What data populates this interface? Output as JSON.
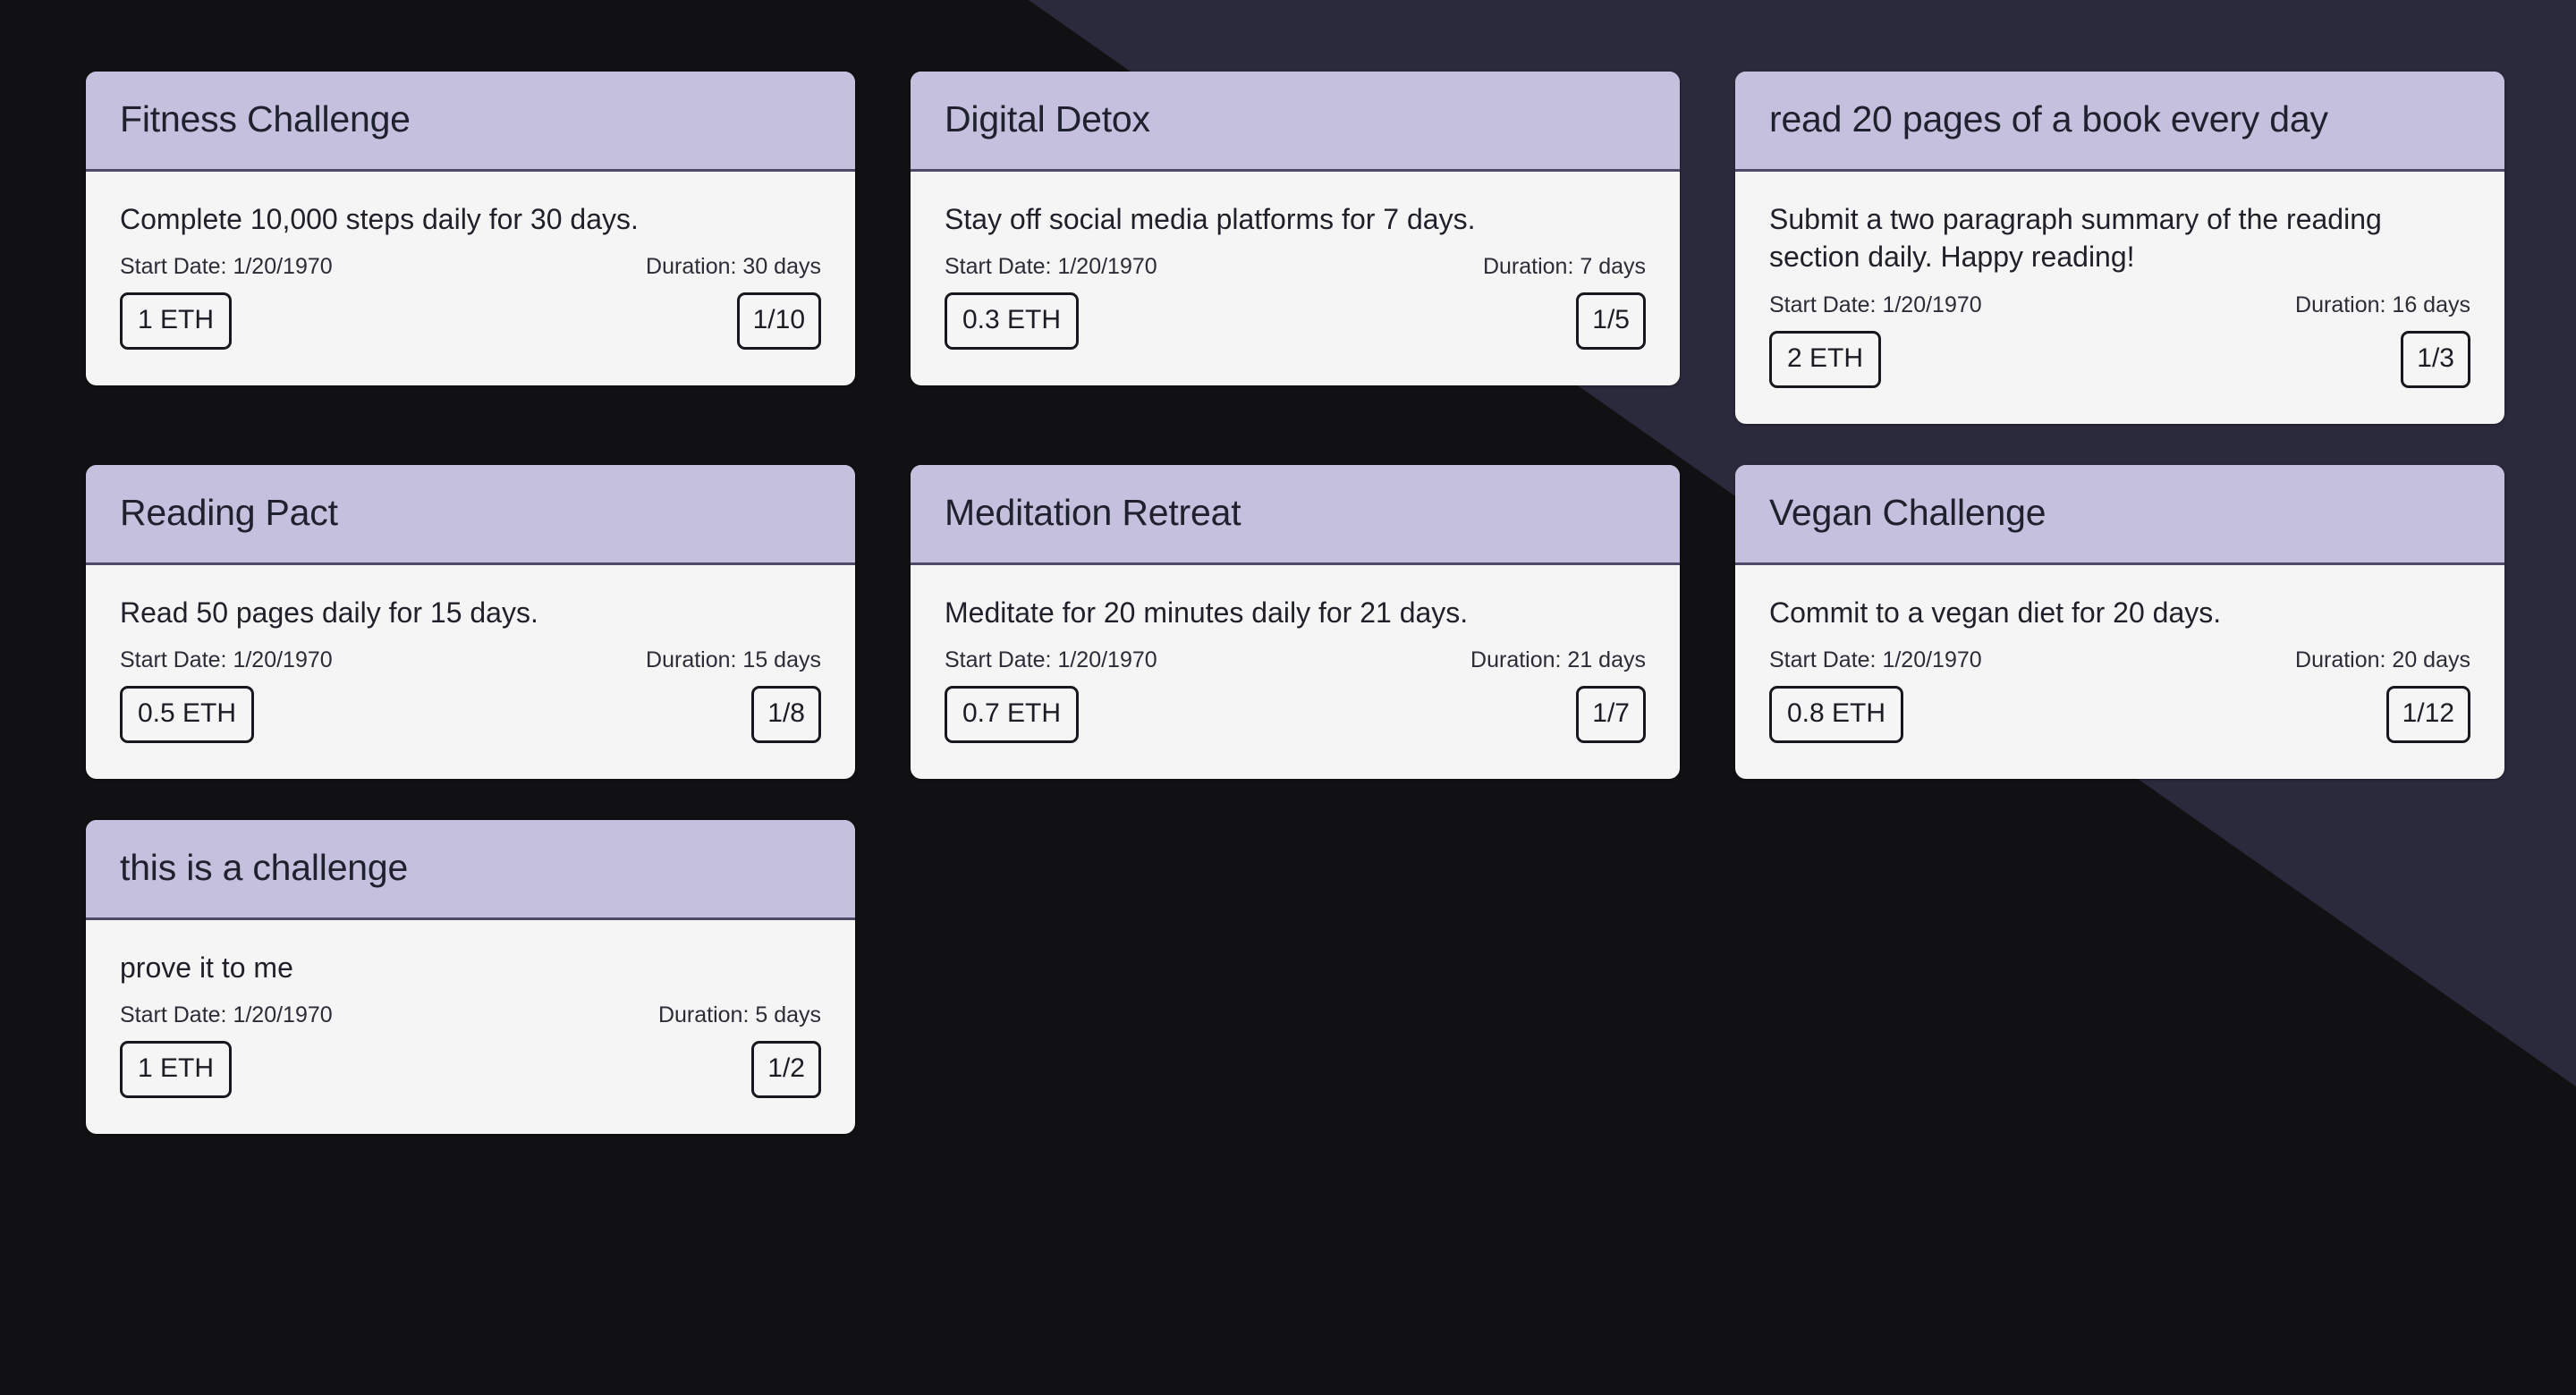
{
  "theme": {
    "background_dark": "#111113",
    "background_diagonal": "#2b2a3c",
    "card_header_bg": "#c4c0de",
    "card_header_border": "#4e4b68",
    "card_body_bg": "#f5f5f5",
    "text_primary": "#1f2029",
    "pill_border": "#17181d"
  },
  "labels": {
    "start_date_prefix": "Start Date:",
    "duration_prefix": "Duration:",
    "currency_suffix": "ETH",
    "duration_suffix": "days"
  },
  "cards": [
    {
      "title": "Fitness Challenge",
      "description": "Complete 10,000 steps daily for 30 days.",
      "start_date": "Start Date: 1/20/1970",
      "duration": "Duration: 30 days",
      "stake": "1 ETH",
      "progress": "1/10"
    },
    {
      "title": "Digital Detox",
      "description": "Stay off social media platforms for 7 days.",
      "start_date": "Start Date: 1/20/1970",
      "duration": "Duration: 7 days",
      "stake": "0.3 ETH",
      "progress": "1/5"
    },
    {
      "title": "read 20 pages of a book every day",
      "description": "Submit a two paragraph summary of the reading section daily. Happy reading!",
      "start_date": "Start Date: 1/20/1970",
      "duration": "Duration: 16 days",
      "stake": "2 ETH",
      "progress": "1/3"
    },
    {
      "title": "Reading Pact",
      "description": "Read 50 pages daily for 15 days.",
      "start_date": "Start Date: 1/20/1970",
      "duration": "Duration: 15 days",
      "stake": "0.5 ETH",
      "progress": "1/8"
    },
    {
      "title": "Meditation Retreat",
      "description": "Meditate for 20 minutes daily for 21 days.",
      "start_date": "Start Date: 1/20/1970",
      "duration": "Duration: 21 days",
      "stake": "0.7 ETH",
      "progress": "1/7"
    },
    {
      "title": "Vegan Challenge",
      "description": "Commit to a vegan diet for 20 days.",
      "start_date": "Start Date: 1/20/1970",
      "duration": "Duration: 20 days",
      "stake": "0.8 ETH",
      "progress": "1/12"
    },
    {
      "title": "this is a challenge",
      "description": "prove it to me",
      "start_date": "Start Date: 1/20/1970",
      "duration": "Duration: 5 days",
      "stake": "1 ETH",
      "progress": "1/2"
    }
  ]
}
